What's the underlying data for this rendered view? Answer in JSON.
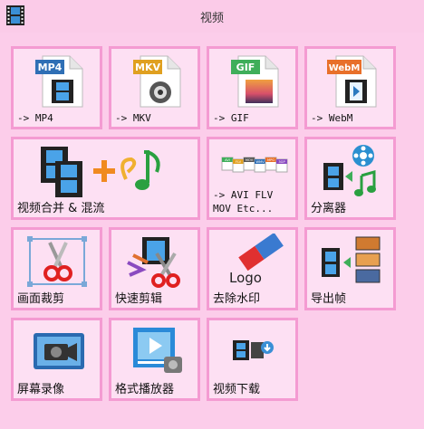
{
  "window": {
    "title": "视频",
    "icon": "film-strip-icon"
  },
  "tiles": [
    {
      "name": "tile-convert-mp4",
      "label": "-> MP4",
      "icon": "mp4-file-icon",
      "badge": "MP4"
    },
    {
      "name": "tile-convert-mkv",
      "label": "-> MKV",
      "icon": "mkv-file-icon",
      "badge": "MKV"
    },
    {
      "name": "tile-convert-gif",
      "label": "-> GIF",
      "icon": "gif-file-icon",
      "badge": "GIF"
    },
    {
      "name": "tile-convert-webm",
      "label": "-> WebM",
      "icon": "webm-file-icon",
      "badge": "WebM"
    },
    {
      "name": "tile-merge-mix",
      "label": "视频合并 & 混流",
      "icon": "merge-video-music-icon"
    },
    {
      "name": "tile-convert-other",
      "label": "-> AVI FLV\nMOV Etc...",
      "icon": "multi-format-icon"
    },
    {
      "name": "tile-separator",
      "label": "分离器",
      "icon": "split-av-icon"
    },
    {
      "name": "tile-crop",
      "label": "画面裁剪",
      "icon": "crop-scissors-icon"
    },
    {
      "name": "tile-fast-cut",
      "label": "快速剪辑",
      "icon": "fast-cut-icon"
    },
    {
      "name": "tile-remove-watermark",
      "label": "去除水印",
      "icon": "eraser-logo-icon",
      "logo_text": "Logo"
    },
    {
      "name": "tile-export-frames",
      "label": "导出帧",
      "icon": "export-frames-icon"
    },
    {
      "name": "tile-screen-record",
      "label": "屏幕录像",
      "icon": "screen-record-icon"
    },
    {
      "name": "tile-format-player",
      "label": "格式播放器",
      "icon": "media-player-icon"
    },
    {
      "name": "tile-video-download",
      "label": "视频下载",
      "icon": "video-download-icon"
    }
  ],
  "format_chips": [
    "AVI",
    "FLV",
    "MOV",
    "WMV",
    "MPG",
    "3GP"
  ],
  "colors": {
    "background": "#fccdea",
    "tile_border": "#f49bd2",
    "tile_fill": "#fde0f3",
    "mp4_badge": "#2f6fb5",
    "mkv_badge": "#e0a020",
    "gif_badge": "#3fae5a",
    "webm_badge": "#e8702a"
  }
}
